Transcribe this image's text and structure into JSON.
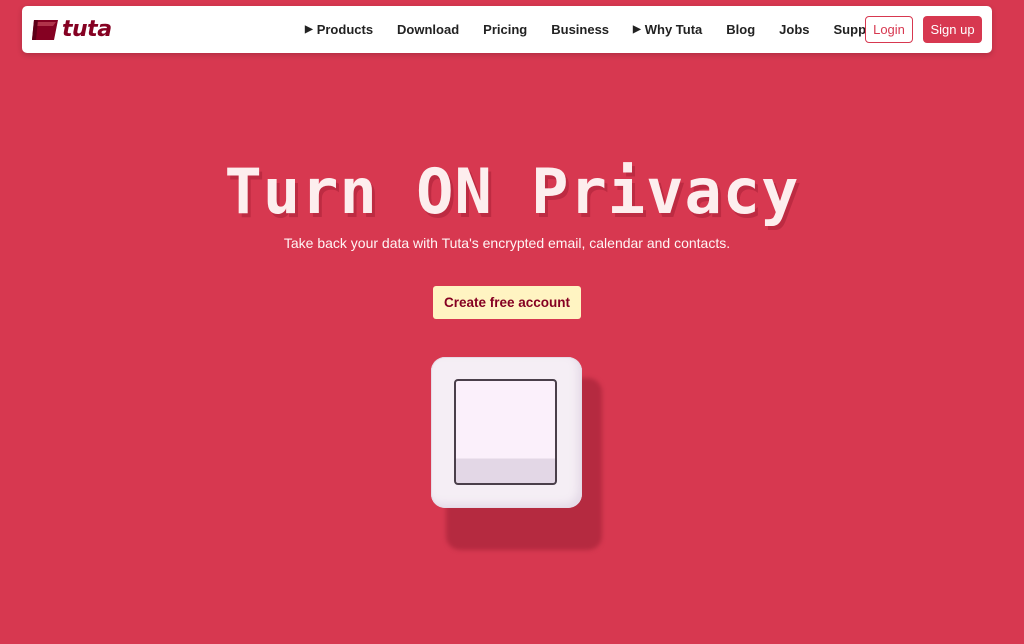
{
  "brand": {
    "name": "tuta",
    "accent": "#d73850",
    "dark_accent": "#850122"
  },
  "nav": {
    "items": [
      {
        "label": "Products",
        "has_arrow": true
      },
      {
        "label": "Download",
        "has_arrow": false
      },
      {
        "label": "Pricing",
        "has_arrow": false
      },
      {
        "label": "Business",
        "has_arrow": false
      },
      {
        "label": "Why Tuta",
        "has_arrow": true
      },
      {
        "label": "Blog",
        "has_arrow": false
      },
      {
        "label": "Jobs",
        "has_arrow": false
      },
      {
        "label": "Support",
        "has_arrow": false
      }
    ],
    "arrow_glyph": "▶",
    "login_label": "Login",
    "signup_label": "Sign up"
  },
  "hero": {
    "title": "Turn ON Privacy",
    "subtitle": "Take back your data with Tuta's encrypted email, calendar and contacts.",
    "cta_label": "Create free account",
    "cta_color": "#fff4c2"
  },
  "switch": {
    "icon": "light-switch-icon",
    "state": "off"
  }
}
